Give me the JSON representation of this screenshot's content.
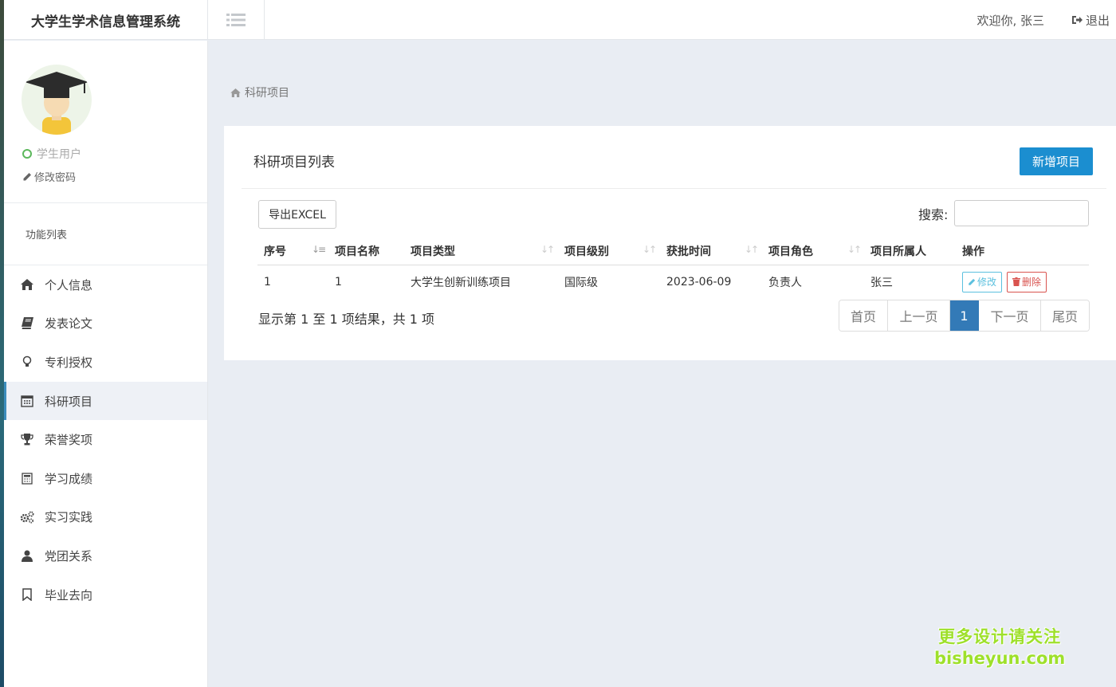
{
  "app": {
    "title": "大学生学术信息管理系统"
  },
  "header": {
    "welcome": "欢迎你, 张三",
    "logout_label": "退出"
  },
  "profile": {
    "role": "学生用户",
    "change_password": "修改密码"
  },
  "sidebar": {
    "section_title": "功能列表",
    "items": [
      {
        "label": "个人信息",
        "icon": "home-icon"
      },
      {
        "label": "发表论文",
        "icon": "book-icon"
      },
      {
        "label": "专利授权",
        "icon": "lightbulb-icon"
      },
      {
        "label": "科研项目",
        "icon": "calendar-icon",
        "active": true
      },
      {
        "label": "荣誉奖项",
        "icon": "trophy-icon"
      },
      {
        "label": "学习成绩",
        "icon": "calculator-icon"
      },
      {
        "label": "实习实践",
        "icon": "gears-icon"
      },
      {
        "label": "党团关系",
        "icon": "user-icon"
      },
      {
        "label": "毕业去向",
        "icon": "bookmark-icon"
      }
    ]
  },
  "breadcrumb": {
    "label": "科研项目"
  },
  "panel": {
    "title": "科研项目列表",
    "add_button": "新增项目",
    "export_button": "导出EXCEL",
    "search_label": "搜索:",
    "search_value": ""
  },
  "table": {
    "headers": [
      "序号",
      "项目名称",
      "项目类型",
      "项目级别",
      "获批时间",
      "项目角色",
      "项目所属人",
      "操作"
    ],
    "rows": [
      {
        "no": "1",
        "name": "1",
        "type": "大学生创新训练项目",
        "level": "国际级",
        "date": "2023-06-09",
        "role": "负责人",
        "owner": "张三"
      }
    ],
    "edit_label": "修改",
    "delete_label": "删除"
  },
  "pagination": {
    "info": "显示第 1 至 1 项结果，共 1 项",
    "first": "首页",
    "prev": "上一页",
    "current": "1",
    "next": "下一页",
    "last": "尾页"
  },
  "watermark": {
    "line1": "更多设计请关注",
    "line2": "bisheyun.com"
  },
  "colors": {
    "primary": "#1b8ed0",
    "active_page": "#337ab7",
    "edit": "#5bc0de",
    "delete": "#d9534f",
    "online": "#5cb85c"
  }
}
